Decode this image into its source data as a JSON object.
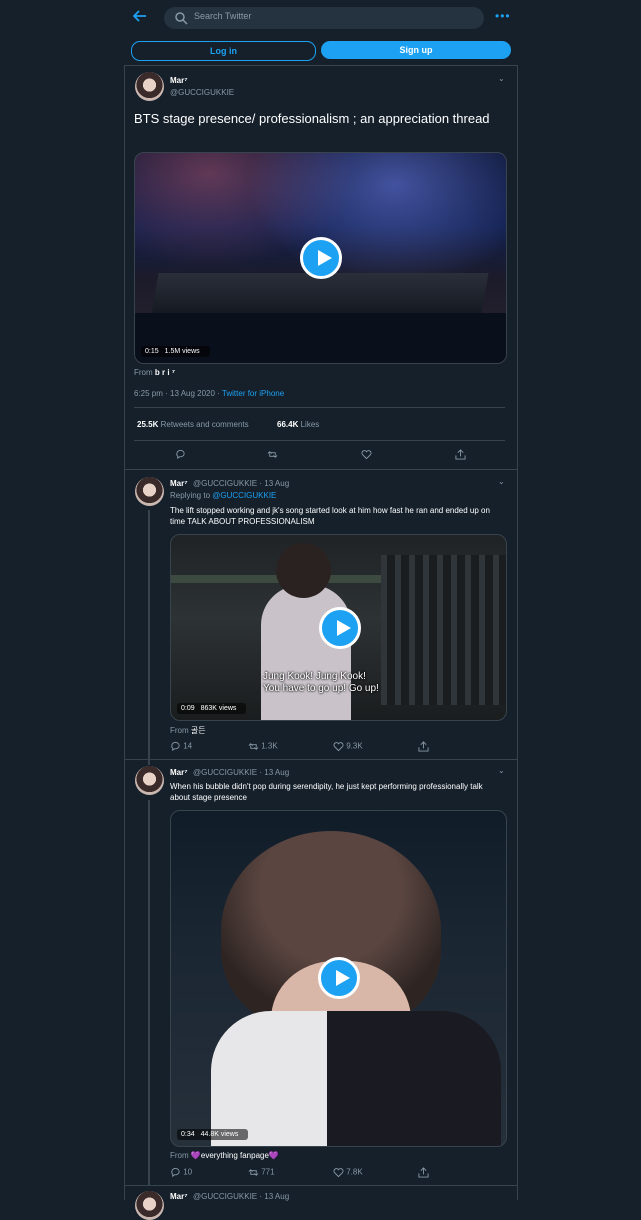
{
  "topbar": {
    "search_placeholder": "Search Twitter",
    "login_label": "Log in",
    "signup_label": "Sign up"
  },
  "colors": {
    "accent": "#1da1f2",
    "background": "#15202b",
    "border": "#38444d",
    "muted": "#8899a6"
  },
  "main": {
    "name": "Mar⁷",
    "handle": "@GUCCIGUKKIE",
    "text": "BTS stage presence/ professionalism ; an appreciation thread",
    "video": {
      "duration": "0:15",
      "views": "1.5M views"
    },
    "from_label": "From",
    "from_name": "b r i ⁷",
    "time": "6:25 pm · 13 Aug 2020 · ",
    "source": "Twitter for iPhone",
    "retweets_count": "25.5K",
    "retweets_label": "Retweets and comments",
    "likes_count": "66.4K",
    "likes_label": "Likes"
  },
  "replies": [
    {
      "name": "Mar⁷",
      "handle_date": "@GUCCIGUKKIE · 13 Aug",
      "replying_label": "Replying to",
      "replying_handle": "@GUCCIGUKKIE",
      "text": "The lift stopped working and jk's song started look at him how fast he ran and ended up on time TALK ABOUT PROFESSIONALISM",
      "video": {
        "duration": "0:09",
        "views": "863K views",
        "subtitle1": "Jung Kook! Jung Kook!",
        "subtitle2": "You have to go up! Go up!"
      },
      "from_label": "From",
      "from_name": "골든",
      "replies_count": "14",
      "retweets_count": "1.3K",
      "likes_count": "9.3K"
    },
    {
      "name": "Mar⁷",
      "handle_date": "@GUCCIGUKKIE · 13 Aug",
      "text": "When his bubble didn't pop during serendipity, he just kept performing professionally talk about stage presence",
      "video": {
        "duration": "0:34",
        "views": "44.8K views"
      },
      "from_label": "From",
      "from_name": "💜everything fanpage💜",
      "replies_count": "10",
      "retweets_count": "771",
      "likes_count": "7.8K"
    },
    {
      "name": "Mar⁷",
      "handle_date": "@GUCCIGUKKIE · 13 Aug"
    }
  ]
}
